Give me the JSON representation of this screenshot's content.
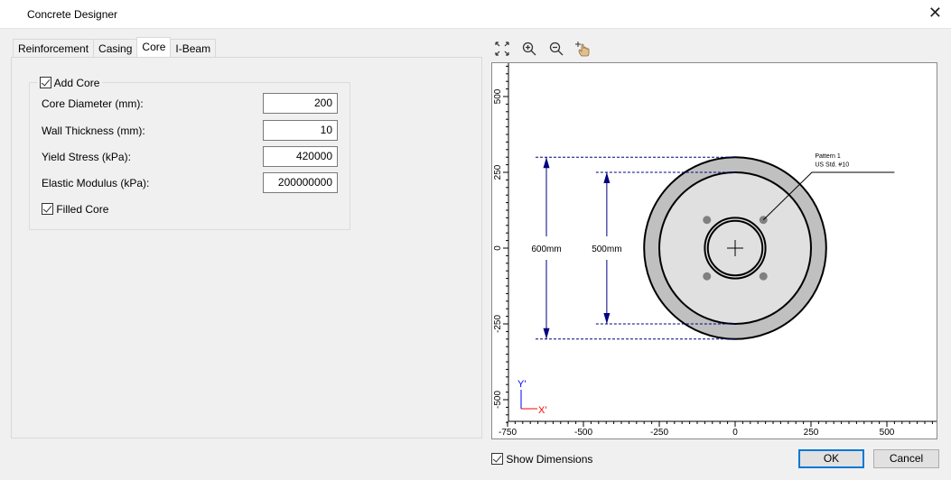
{
  "window": {
    "title": "Concrete Designer"
  },
  "tabs": [
    {
      "label": "Reinforcement"
    },
    {
      "label": "Casing"
    },
    {
      "label": "Core",
      "active": true
    },
    {
      "label": "I-Beam"
    }
  ],
  "core": {
    "add_core": {
      "label": "Add Core",
      "checked": true
    },
    "fields": [
      {
        "label": "Core Diameter (mm):",
        "value": "200"
      },
      {
        "label": "Wall Thickness (mm):",
        "value": "10"
      },
      {
        "label": "Yield Stress (kPa):",
        "value": "420000"
      },
      {
        "label": "Elastic Modulus (kPa):",
        "value": "200000000"
      }
    ],
    "filled_core": {
      "label": "Filled Core",
      "checked": true
    }
  },
  "toolbar": [
    "fit-extents-icon",
    "zoom-in-icon",
    "zoom-out-icon",
    "pan-hand-icon"
  ],
  "drawing": {
    "x_ticks": [
      "-750",
      "-500",
      "-250",
      "0",
      "250",
      "500"
    ],
    "y_ticks": [
      "500",
      "250",
      "0",
      "-250",
      "-500"
    ],
    "outer_diameter_mm": 600,
    "inner_diameter_mm": 500,
    "core_diameter_mm": 200,
    "core_wall_mm": 10,
    "bars": [
      [
        -93,
        93
      ],
      [
        93,
        93
      ],
      [
        -93,
        -93
      ],
      [
        93,
        -93
      ]
    ],
    "dim_outer": "600mm",
    "dim_inner": "500mm",
    "callout": [
      "Pattern 1",
      "US Std. #10"
    ],
    "axis_x": "X'",
    "axis_y": "Y'",
    "colors": {
      "casing": "#c0c0c0",
      "concrete": "#e0e0e0",
      "bar": "#808080",
      "dimension": "#000080",
      "axis_x": "#ff0000",
      "axis_y": "#0000ff"
    }
  },
  "footer": {
    "show_dimensions": {
      "label": "Show Dimensions",
      "checked": true
    },
    "ok": "OK",
    "cancel": "Cancel"
  }
}
